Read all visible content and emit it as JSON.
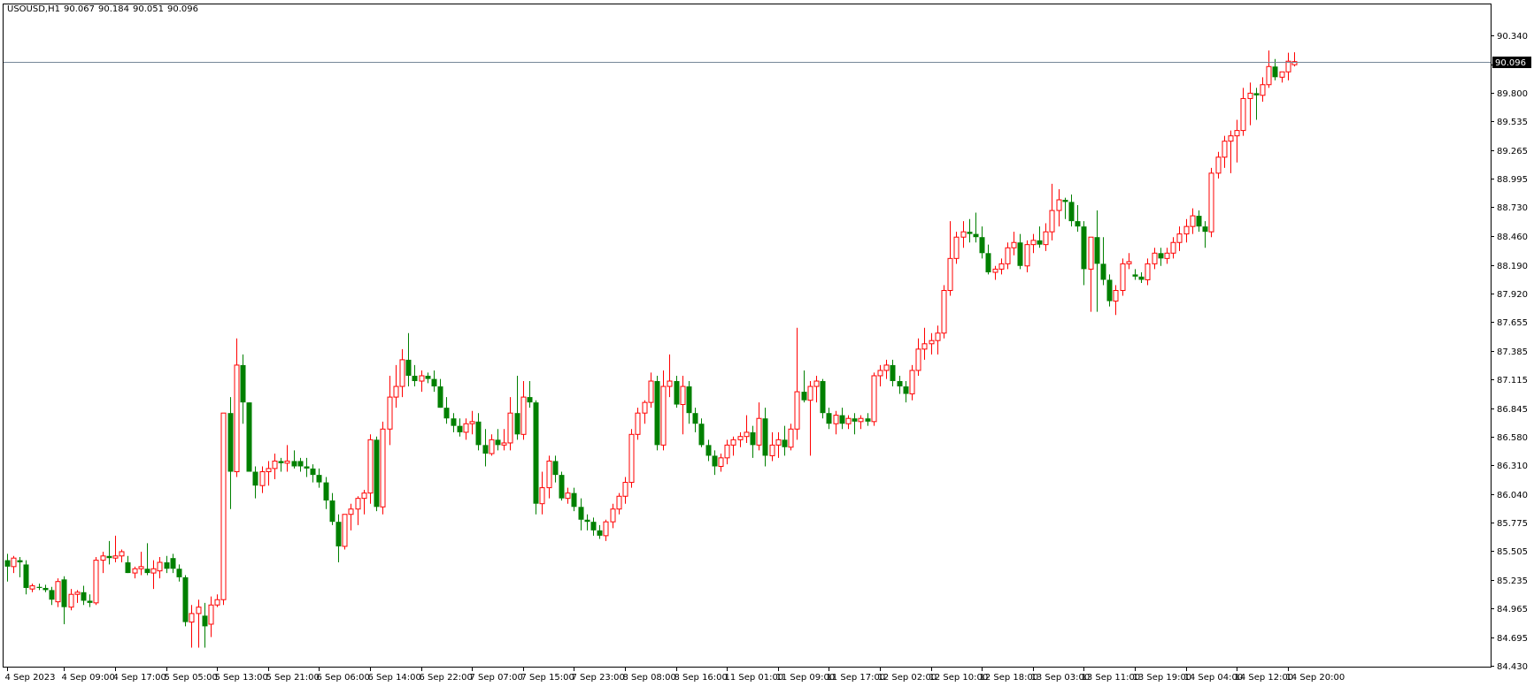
{
  "header": {
    "symbol": "USOUSD,H1",
    "open": "90.067",
    "high": "90.184",
    "low": "90.051",
    "close": "90.096"
  },
  "current_price_label": "90.096",
  "colors": {
    "bull": "#ff0000",
    "bear": "#008000",
    "price_line": "#778899",
    "price_label_bg": "#000000",
    "price_label_text": "#ffffff",
    "axis": "#000000",
    "background": "#ffffff"
  },
  "chart_data": {
    "type": "candlestick",
    "ylim": [
      84.43,
      90.475
    ],
    "current_price": 90.096,
    "y_ticks": [
      "90.340",
      "90.070",
      "89.800",
      "89.535",
      "89.265",
      "88.995",
      "88.730",
      "88.460",
      "88.190",
      "87.920",
      "87.655",
      "87.385",
      "87.115",
      "86.845",
      "86.580",
      "86.310",
      "86.040",
      "85.775",
      "85.505",
      "85.235",
      "84.965",
      "84.695",
      "84.430"
    ],
    "x_ticks": [
      {
        "label": "4 Sep 2023",
        "index": 0
      },
      {
        "label": "4 Sep 09:00",
        "index": 9
      },
      {
        "label": "4 Sep 17:00",
        "index": 17
      },
      {
        "label": "5 Sep 05:00",
        "index": 25
      },
      {
        "label": "5 Sep 13:00",
        "index": 33
      },
      {
        "label": "5 Sep 21:00",
        "index": 41
      },
      {
        "label": "6 Sep 06:00",
        "index": 49
      },
      {
        "label": "6 Sep 14:00",
        "index": 57
      },
      {
        "label": "6 Sep 22:00",
        "index": 65
      },
      {
        "label": "7 Sep 07:00",
        "index": 73
      },
      {
        "label": "7 Sep 15:00",
        "index": 81
      },
      {
        "label": "7 Sep 23:00",
        "index": 89
      },
      {
        "label": "8 Sep 08:00",
        "index": 97
      },
      {
        "label": "8 Sep 16:00",
        "index": 105
      },
      {
        "label": "11 Sep 01:00",
        "index": 113
      },
      {
        "label": "11 Sep 09:00",
        "index": 121
      },
      {
        "label": "11 Sep 17:00",
        "index": 129
      },
      {
        "label": "12 Sep 02:00",
        "index": 137
      },
      {
        "label": "12 Sep 10:00",
        "index": 145
      },
      {
        "label": "12 Sep 18:00",
        "index": 153
      },
      {
        "label": "13 Sep 03:00",
        "index": 161
      },
      {
        "label": "13 Sep 11:00",
        "index": 169
      },
      {
        "label": "13 Sep 19:00",
        "index": 177
      },
      {
        "label": "14 Sep 04:00",
        "index": 185
      },
      {
        "label": "14 Sep 12:00",
        "index": 193
      },
      {
        "label": "14 Sep 20:00",
        "index": 201
      }
    ],
    "ohlc": [
      [
        85.42,
        85.48,
        85.22,
        85.36
      ],
      [
        85.36,
        85.46,
        85.3,
        85.44
      ],
      [
        85.42,
        85.45,
        85.26,
        85.4
      ],
      [
        85.38,
        85.42,
        85.1,
        85.16
      ],
      [
        85.15,
        85.2,
        85.12,
        85.18
      ],
      [
        85.17,
        85.2,
        85.14,
        85.16
      ],
      [
        85.16,
        85.19,
        85.12,
        85.14
      ],
      [
        85.14,
        85.17,
        85.0,
        85.05
      ],
      [
        85.03,
        85.25,
        84.98,
        85.22
      ],
      [
        85.24,
        85.27,
        84.82,
        84.98
      ],
      [
        84.98,
        85.15,
        84.95,
        85.1
      ],
      [
        85.1,
        85.14,
        85.02,
        85.12
      ],
      [
        85.12,
        85.18,
        85.0,
        85.04
      ],
      [
        85.04,
        85.1,
        84.98,
        85.02
      ],
      [
        85.02,
        85.45,
        85.0,
        85.42
      ],
      [
        85.42,
        85.5,
        85.3,
        85.46
      ],
      [
        85.46,
        85.6,
        85.38,
        85.44
      ],
      [
        85.44,
        85.65,
        85.4,
        85.46
      ],
      [
        85.46,
        85.52,
        85.4,
        85.5
      ],
      [
        85.4,
        85.46,
        85.3,
        85.3
      ],
      [
        85.3,
        85.36,
        85.25,
        85.34
      ],
      [
        85.34,
        85.5,
        85.28,
        85.36
      ],
      [
        85.34,
        85.58,
        85.28,
        85.3
      ],
      [
        85.3,
        85.42,
        85.15,
        85.34
      ],
      [
        85.32,
        85.45,
        85.25,
        85.4
      ],
      [
        85.4,
        85.46,
        85.3,
        85.34
      ],
      [
        85.44,
        85.48,
        85.3,
        85.34
      ],
      [
        85.34,
        85.38,
        85.22,
        85.26
      ],
      [
        85.26,
        85.28,
        84.8,
        84.84
      ],
      [
        84.84,
        85.0,
        84.6,
        84.92
      ],
      [
        84.92,
        85.05,
        84.6,
        84.98
      ],
      [
        84.9,
        85.02,
        84.6,
        84.8
      ],
      [
        84.82,
        85.08,
        84.7,
        85.0
      ],
      [
        85.0,
        85.1,
        84.98,
        85.05
      ],
      [
        85.05,
        86.8,
        85.0,
        86.8
      ],
      [
        86.8,
        86.95,
        85.9,
        86.25
      ],
      [
        86.25,
        87.5,
        86.2,
        87.25
      ],
      [
        87.25,
        87.35,
        86.7,
        86.9
      ],
      [
        86.9,
        86.9,
        86.25,
        86.25
      ],
      [
        86.25,
        86.3,
        86.0,
        86.12
      ],
      [
        86.12,
        86.3,
        86.05,
        86.25
      ],
      [
        86.25,
        86.35,
        86.12,
        86.28
      ],
      [
        86.28,
        86.42,
        86.18,
        86.35
      ],
      [
        86.35,
        86.38,
        86.25,
        86.33
      ],
      [
        86.33,
        86.5,
        86.25,
        86.35
      ],
      [
        86.35,
        86.45,
        86.28,
        86.3
      ],
      [
        86.35,
        86.38,
        86.25,
        86.3
      ],
      [
        86.3,
        86.38,
        86.2,
        86.28
      ],
      [
        86.28,
        86.32,
        86.15,
        86.22
      ],
      [
        86.22,
        86.28,
        86.1,
        86.15
      ],
      [
        86.15,
        86.2,
        85.9,
        85.98
      ],
      [
        85.98,
        86.05,
        85.75,
        85.78
      ],
      [
        85.78,
        85.85,
        85.4,
        85.55
      ],
      [
        85.55,
        85.85,
        85.52,
        85.85
      ],
      [
        85.85,
        85.95,
        85.7,
        85.9
      ],
      [
        85.9,
        86.02,
        85.75,
        86.0
      ],
      [
        86.0,
        86.08,
        85.85,
        86.05
      ],
      [
        86.05,
        86.6,
        85.95,
        86.55
      ],
      [
        86.55,
        86.58,
        85.88,
        85.92
      ],
      [
        85.92,
        86.72,
        85.85,
        86.65
      ],
      [
        86.65,
        87.15,
        86.5,
        86.95
      ],
      [
        86.95,
        87.25,
        86.85,
        87.05
      ],
      [
        87.05,
        87.4,
        86.95,
        87.3
      ],
      [
        87.3,
        87.55,
        87.05,
        87.15
      ],
      [
        87.15,
        87.25,
        87.05,
        87.1
      ],
      [
        87.1,
        87.2,
        87.0,
        87.15
      ],
      [
        87.15,
        87.18,
        87.08,
        87.12
      ],
      [
        87.12,
        87.2,
        87.0,
        87.05
      ],
      [
        87.05,
        87.12,
        86.85,
        86.85
      ],
      [
        86.85,
        86.95,
        86.7,
        86.75
      ],
      [
        86.75,
        86.8,
        86.62,
        86.68
      ],
      [
        86.68,
        86.75,
        86.58,
        86.62
      ],
      [
        86.62,
        86.75,
        86.55,
        86.7
      ],
      [
        86.7,
        86.82,
        86.6,
        86.72
      ],
      [
        86.72,
        86.8,
        86.45,
        86.5
      ],
      [
        86.5,
        86.65,
        86.3,
        86.42
      ],
      [
        86.42,
        86.6,
        86.4,
        86.55
      ],
      [
        86.55,
        86.65,
        86.45,
        86.5
      ],
      [
        86.5,
        86.65,
        86.45,
        86.52
      ],
      [
        86.52,
        86.95,
        86.45,
        86.8
      ],
      [
        86.8,
        87.15,
        86.55,
        86.6
      ],
      [
        86.6,
        87.1,
        86.55,
        86.95
      ],
      [
        86.95,
        87.1,
        86.85,
        86.9
      ],
      [
        86.9,
        86.92,
        85.85,
        85.95
      ],
      [
        85.95,
        86.25,
        85.85,
        86.1
      ],
      [
        86.1,
        86.4,
        86.0,
        86.35
      ],
      [
        86.35,
        86.4,
        86.15,
        86.22
      ],
      [
        86.22,
        86.25,
        85.98,
        86.0
      ],
      [
        86.0,
        86.1,
        85.95,
        86.05
      ],
      [
        86.05,
        86.1,
        85.88,
        85.92
      ],
      [
        85.92,
        86.0,
        85.7,
        85.8
      ],
      [
        85.8,
        85.85,
        85.7,
        85.78
      ],
      [
        85.78,
        85.82,
        85.65,
        85.7
      ],
      [
        85.7,
        85.75,
        85.62,
        85.65
      ],
      [
        85.65,
        85.8,
        85.6,
        85.78
      ],
      [
        85.78,
        85.95,
        85.72,
        85.9
      ],
      [
        85.9,
        86.05,
        85.85,
        86.02
      ],
      [
        86.02,
        86.2,
        85.95,
        86.15
      ],
      [
        86.15,
        86.65,
        86.1,
        86.6
      ],
      [
        86.6,
        86.85,
        86.55,
        86.8
      ],
      [
        86.8,
        86.92,
        86.7,
        86.9
      ],
      [
        86.9,
        87.18,
        86.85,
        87.1
      ],
      [
        87.1,
        87.15,
        86.45,
        86.5
      ],
      [
        86.5,
        87.2,
        86.45,
        87.05
      ],
      [
        87.05,
        87.35,
        86.95,
        87.1
      ],
      [
        87.1,
        87.15,
        86.85,
        86.88
      ],
      [
        86.88,
        87.15,
        86.6,
        87.05
      ],
      [
        87.05,
        87.1,
        86.7,
        86.8
      ],
      [
        86.8,
        86.85,
        86.62,
        86.7
      ],
      [
        86.7,
        86.75,
        86.48,
        86.5
      ],
      [
        86.5,
        86.55,
        86.35,
        86.4
      ],
      [
        86.4,
        86.45,
        86.22,
        86.3
      ],
      [
        86.3,
        86.42,
        86.25,
        86.38
      ],
      [
        86.38,
        86.55,
        86.32,
        86.5
      ],
      [
        86.5,
        86.58,
        86.4,
        86.55
      ],
      [
        86.55,
        86.62,
        86.48,
        86.58
      ],
      [
        86.58,
        86.78,
        86.52,
        86.62
      ],
      [
        86.62,
        86.68,
        86.38,
        86.5
      ],
      [
        86.5,
        86.9,
        86.45,
        86.75
      ],
      [
        86.75,
        86.85,
        86.3,
        86.4
      ],
      [
        86.4,
        86.62,
        86.35,
        86.5
      ],
      [
        86.5,
        86.62,
        86.38,
        86.55
      ],
      [
        86.55,
        86.68,
        86.4,
        86.48
      ],
      [
        86.48,
        86.7,
        86.45,
        86.65
      ],
      [
        86.65,
        87.6,
        86.55,
        87.0
      ],
      [
        87.0,
        87.2,
        86.9,
        86.92
      ],
      [
        86.92,
        87.1,
        86.4,
        87.05
      ],
      [
        87.05,
        87.15,
        86.9,
        87.1
      ],
      [
        87.1,
        87.12,
        86.75,
        86.8
      ],
      [
        86.8,
        86.85,
        86.65,
        86.7
      ],
      [
        86.7,
        86.82,
        86.6,
        86.78
      ],
      [
        86.78,
        86.85,
        86.65,
        86.7
      ],
      [
        86.7,
        86.78,
        86.65,
        86.75
      ],
      [
        86.75,
        86.8,
        86.6,
        86.72
      ],
      [
        86.72,
        86.78,
        86.65,
        86.75
      ],
      [
        86.75,
        86.8,
        86.68,
        86.72
      ],
      [
        86.72,
        87.18,
        86.68,
        87.15
      ],
      [
        87.15,
        87.25,
        87.05,
        87.2
      ],
      [
        87.2,
        87.3,
        87.12,
        87.25
      ],
      [
        87.25,
        87.3,
        87.05,
        87.1
      ],
      [
        87.1,
        87.15,
        86.98,
        87.05
      ],
      [
        87.05,
        87.1,
        86.9,
        86.98
      ],
      [
        86.98,
        87.25,
        86.92,
        87.2
      ],
      [
        87.2,
        87.5,
        87.15,
        87.4
      ],
      [
        87.4,
        87.6,
        87.3,
        87.45
      ],
      [
        87.45,
        87.55,
        87.35,
        87.48
      ],
      [
        87.48,
        87.62,
        87.35,
        87.55
      ],
      [
        87.55,
        88.0,
        87.5,
        87.95
      ],
      [
        87.95,
        88.6,
        87.9,
        88.25
      ],
      [
        88.25,
        88.5,
        88.2,
        88.45
      ],
      [
        88.45,
        88.6,
        88.35,
        88.5
      ],
      [
        88.5,
        88.62,
        88.4,
        88.48
      ],
      [
        88.48,
        88.68,
        88.4,
        88.45
      ],
      [
        88.45,
        88.55,
        88.25,
        88.3
      ],
      [
        88.3,
        88.38,
        88.1,
        88.12
      ],
      [
        88.12,
        88.18,
        88.05,
        88.15
      ],
      [
        88.15,
        88.25,
        88.1,
        88.2
      ],
      [
        88.2,
        88.4,
        88.15,
        88.35
      ],
      [
        88.35,
        88.5,
        88.28,
        88.4
      ],
      [
        88.4,
        88.48,
        88.15,
        88.18
      ],
      [
        88.18,
        88.42,
        88.12,
        88.38
      ],
      [
        88.38,
        88.48,
        88.3,
        88.42
      ],
      [
        88.42,
        88.55,
        88.35,
        88.38
      ],
      [
        88.38,
        88.58,
        88.32,
        88.5
      ],
      [
        88.5,
        88.95,
        88.42,
        88.7
      ],
      [
        88.7,
        88.9,
        88.55,
        88.8
      ],
      [
        88.8,
        88.82,
        88.62,
        88.78
      ],
      [
        88.78,
        88.85,
        88.55,
        88.6
      ],
      [
        88.6,
        88.75,
        88.5,
        88.55
      ],
      [
        88.55,
        88.6,
        88.0,
        88.15
      ],
      [
        88.15,
        88.4,
        87.75,
        88.45
      ],
      [
        88.45,
        88.7,
        87.75,
        88.2
      ],
      [
        88.2,
        88.45,
        88.0,
        88.05
      ],
      [
        88.05,
        88.1,
        87.8,
        87.85
      ],
      [
        87.85,
        88.0,
        87.72,
        87.95
      ],
      [
        87.95,
        88.25,
        87.9,
        88.2
      ],
      [
        88.2,
        88.3,
        88.15,
        88.22
      ],
      [
        88.1,
        88.15,
        88.05,
        88.08
      ],
      [
        88.08,
        88.12,
        88.02,
        88.05
      ],
      [
        88.05,
        88.25,
        88.0,
        88.2
      ],
      [
        88.2,
        88.35,
        88.15,
        88.3
      ],
      [
        88.3,
        88.35,
        88.18,
        88.25
      ],
      [
        88.25,
        88.35,
        88.2,
        88.3
      ],
      [
        88.3,
        88.45,
        88.25,
        88.4
      ],
      [
        88.4,
        88.55,
        88.32,
        88.48
      ],
      [
        88.48,
        88.62,
        88.4,
        88.55
      ],
      [
        88.55,
        88.72,
        88.48,
        88.65
      ],
      [
        88.65,
        88.7,
        88.5,
        88.55
      ],
      [
        88.55,
        88.6,
        88.35,
        88.5
      ],
      [
        88.5,
        89.1,
        88.45,
        89.05
      ],
      [
        89.05,
        89.25,
        89.0,
        89.2
      ],
      [
        89.2,
        89.4,
        89.1,
        89.35
      ],
      [
        89.35,
        89.45,
        89.05,
        89.4
      ],
      [
        89.4,
        89.55,
        89.15,
        89.45
      ],
      [
        89.45,
        89.85,
        89.4,
        89.75
      ],
      [
        89.75,
        89.9,
        89.5,
        89.8
      ],
      [
        89.8,
        89.85,
        89.55,
        89.78
      ],
      [
        89.78,
        89.95,
        89.72,
        89.88
      ],
      [
        89.88,
        90.2,
        89.85,
        90.05
      ],
      [
        90.05,
        90.12,
        89.92,
        89.95
      ],
      [
        89.95,
        90.0,
        89.9,
        90.0
      ],
      [
        90.0,
        90.18,
        89.92,
        90.1
      ],
      [
        90.067,
        90.184,
        90.051,
        90.096
      ]
    ]
  }
}
